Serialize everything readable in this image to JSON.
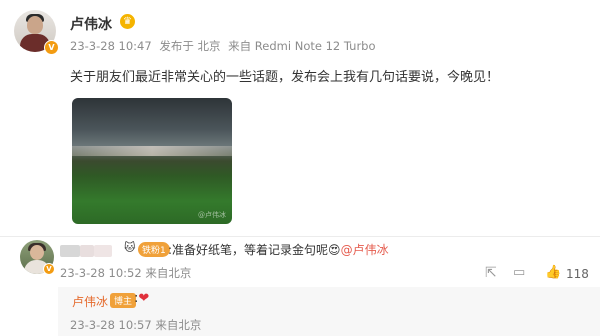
{
  "post": {
    "author": "卢伟冰",
    "date": "23-3-28 10:47",
    "posted_from": "发布于 北京",
    "device": "来自 Redmi Note 12 Turbo",
    "content": "关于朋友们最近非常关心的一些话题，发布会上我有几句话要说，今晚见！",
    "image_watermark": "@卢伟冰"
  },
  "comment": {
    "fan_badge": "铁粉1",
    "text_prefix": ":准备好纸笔，等着记录金句呢",
    "mention": "@卢伟冰",
    "emoji": "😍",
    "date": "23-3-28 10:52",
    "location": "来自北京",
    "like_count": "118",
    "reply": {
      "author": "卢伟冰",
      "tag": "博主",
      "text": ":",
      "heart": "❤",
      "date": "23-3-28 10:57",
      "location": "来自北京"
    }
  },
  "icons": {
    "crown": "crown-icon",
    "verified": "verified-v-icon",
    "share": "share-icon",
    "comment": "comment-icon",
    "like": "like-icon"
  },
  "colors": {
    "accent": "#e56a2c",
    "mention": "#e55b4d",
    "verified": "#f39c12"
  }
}
